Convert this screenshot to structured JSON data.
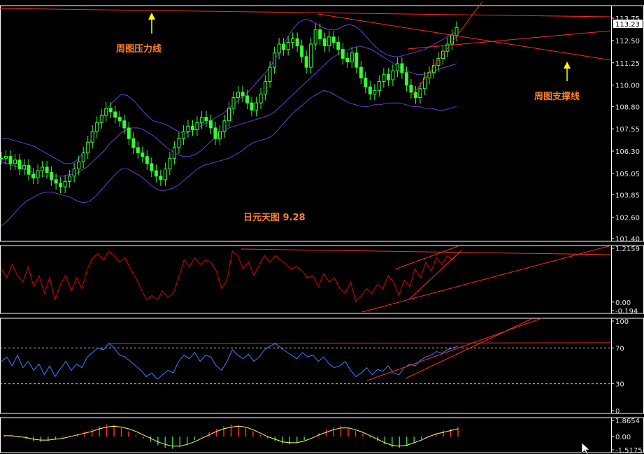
{
  "colors": {
    "background": "#000000",
    "frame": "#ffffff",
    "candle": "#33ff33",
    "bollinger": "#6a3fd8",
    "trendline": "#ff2a2a",
    "oscillator_line": "#e00000",
    "rsi_line": "#3a7fff",
    "annotation_text": "#ff7f2a",
    "arrow": "#ffff00",
    "macd_pos": "#ff2a2a",
    "macd_neg": "#2ecc40",
    "macd_line": "#ffff66"
  },
  "annotations": {
    "weekly_resistance": "周图压力线",
    "weekly_support": "周图支撑线",
    "chart_title": "日元天图  9.28"
  },
  "chart_data": [
    {
      "panel": "price",
      "type": "candlestick",
      "title": "日元天图  9.28",
      "current_price_label": "113.23",
      "ylim": [
        101.4,
        114.3
      ],
      "y_tick_labels": [
        "113.75",
        "112.50",
        "111.25",
        "110.00",
        "108.80",
        "107.55",
        "106.30",
        "105.05",
        "103.85",
        "102.60",
        "101.40"
      ],
      "y_ticks": [
        113.75,
        112.5,
        111.25,
        110.0,
        108.8,
        107.55,
        106.3,
        105.05,
        103.85,
        102.6,
        101.4
      ],
      "close": [
        105.9,
        106.0,
        105.6,
        105.8,
        105.3,
        105.5,
        105.0,
        104.8,
        105.2,
        105.4,
        105.1,
        104.7,
        104.5,
        104.3,
        104.6,
        104.9,
        105.3,
        105.7,
        106.2,
        106.8,
        107.4,
        107.9,
        108.3,
        108.7,
        108.5,
        108.2,
        108.0,
        107.6,
        107.0,
        106.5,
        106.2,
        106.0,
        105.6,
        105.2,
        104.9,
        104.7,
        105.3,
        105.9,
        106.5,
        107.0,
        107.4,
        107.7,
        107.5,
        107.9,
        108.2,
        108.0,
        107.6,
        107.0,
        107.4,
        108.0,
        108.7,
        109.3,
        109.6,
        109.4,
        109.0,
        108.6,
        109.0,
        109.5,
        110.2,
        111.0,
        111.8,
        112.3,
        112.0,
        112.4,
        112.6,
        112.2,
        111.6,
        111.0,
        112.3,
        113.1,
        112.6,
        112.2,
        112.7,
        112.4,
        112.0,
        111.5,
        111.3,
        111.8,
        111.0,
        110.4,
        109.9,
        109.5,
        109.7,
        110.2,
        110.6,
        110.3,
        110.8,
        111.2,
        110.7,
        110.0,
        109.6,
        109.3,
        109.8,
        110.4,
        110.7,
        111.1,
        111.5,
        111.9,
        112.3,
        112.8,
        113.23
      ],
      "ma": [
        105.7,
        105.6,
        105.5,
        105.4,
        105.3,
        105.2,
        105.0,
        104.9,
        104.9,
        104.9,
        104.9,
        104.9,
        105.0,
        105.0,
        105.2,
        105.4,
        105.7,
        106.0,
        106.3,
        106.7,
        107.0,
        107.3,
        107.5,
        107.6,
        107.6,
        107.5,
        107.3,
        107.1,
        106.8,
        106.5,
        106.3,
        106.1,
        106.0,
        106.0,
        106.1,
        106.3,
        106.6,
        106.9,
        107.2,
        107.4,
        107.6,
        107.7,
        107.8,
        107.9,
        108.0,
        108.1,
        108.2,
        108.3,
        108.5,
        108.8,
        109.1,
        109.4,
        109.7,
        110.0,
        110.3,
        110.6,
        110.9,
        111.2,
        111.5,
        111.7,
        111.9,
        112.0,
        112.1,
        112.2,
        112.1,
        112.0,
        111.8,
        111.6,
        111.4,
        111.2,
        111.0,
        110.8,
        110.7,
        110.6,
        110.6,
        110.7,
        110.8,
        110.9,
        111.0,
        111.1,
        111.2
      ],
      "upper_band": [
        107.0,
        107.0,
        106.9,
        106.8,
        106.7,
        106.6,
        106.4,
        106.2,
        106.0,
        105.8,
        105.6,
        105.6,
        105.8,
        106.2,
        106.8,
        107.5,
        108.2,
        108.8,
        109.2,
        109.5,
        109.4,
        109.1,
        108.7,
        108.3,
        108.0,
        107.9,
        107.8,
        107.6,
        107.4,
        107.3,
        107.4,
        107.6,
        107.8,
        108.0,
        108.2,
        108.4,
        108.7,
        109.0,
        109.3,
        109.6,
        110.0,
        110.4,
        110.8,
        111.3,
        111.9,
        112.5,
        113.1,
        113.5,
        113.7,
        113.6,
        113.4,
        113.2,
        113.1,
        113.1,
        113.3,
        113.4,
        113.3,
        113.0,
        112.6,
        112.2,
        111.9,
        111.7,
        111.6,
        111.6,
        111.7,
        111.8,
        111.9,
        112.0,
        112.2,
        112.4,
        112.6,
        112.8,
        113.0
      ],
      "lower_band": [
        102.1,
        102.4,
        102.8,
        103.2,
        103.5,
        103.7,
        103.9,
        104.0,
        104.0,
        103.9,
        103.8,
        103.7,
        103.5,
        103.4,
        103.5,
        103.8,
        104.2,
        104.6,
        105.0,
        105.3,
        105.3,
        105.1,
        104.9,
        104.6,
        104.3,
        104.1,
        104.1,
        104.2,
        104.4,
        104.7,
        105.0,
        105.3,
        105.5,
        105.6,
        105.7,
        105.8,
        105.9,
        106.1,
        106.3,
        106.6,
        106.8,
        106.9,
        107.0,
        107.2,
        107.6,
        108.0,
        108.4,
        108.7,
        109.0,
        109.3,
        109.5,
        109.7,
        109.6,
        109.4,
        109.2,
        109.0,
        108.9,
        108.8,
        108.8,
        108.9,
        108.9,
        109.0,
        109.0,
        109.0,
        108.9,
        108.8,
        108.8,
        108.7,
        108.7,
        108.6,
        108.6,
        108.7,
        108.8
      ]
    },
    {
      "panel": "oscillator",
      "type": "line",
      "ylim": [
        -0.194,
        1.2159
      ],
      "y_tick_labels": [
        "1.2159",
        "0.00",
        "-0.194"
      ],
      "y_ticks": [
        1.2159,
        0.0,
        -0.194
      ],
      "values": [
        0.75,
        0.55,
        0.85,
        0.6,
        0.45,
        0.8,
        0.35,
        0.6,
        0.2,
        0.55,
        0.05,
        0.4,
        0.6,
        0.25,
        0.55,
        0.3,
        0.75,
        1.0,
        1.1,
        0.95,
        1.15,
        1.05,
        0.9,
        1.0,
        0.75,
        0.55,
        0.3,
        0.05,
        0.15,
        0.05,
        0.25,
        0.1,
        0.2,
        0.55,
        0.95,
        0.8,
        1.0,
        0.85,
        0.95,
        0.9,
        0.7,
        0.3,
        0.5,
        1.15,
        1.05,
        0.75,
        0.9,
        0.6,
        0.85,
        1.05,
        0.9,
        1.05,
        0.95,
        0.85,
        0.75,
        0.8,
        0.7,
        0.55,
        0.6,
        0.35,
        0.65,
        0.45,
        0.55,
        0.3,
        0.2,
        0.45,
        0.0,
        0.15,
        0.3,
        0.2,
        0.4,
        0.3,
        0.6,
        0.45,
        0.15,
        0.5,
        0.35,
        0.75,
        0.55,
        0.9,
        0.7,
        1.0,
        0.85,
        1.05,
        0.95,
        1.1
      ]
    },
    {
      "panel": "rsi",
      "type": "line",
      "ylim": [
        0,
        100
      ],
      "y_tick_labels": [
        "100",
        "70",
        "30",
        "0"
      ],
      "y_ticks": [
        100,
        70,
        30,
        0
      ],
      "levels": [
        70,
        30
      ],
      "values": [
        55,
        60,
        50,
        62,
        48,
        55,
        45,
        52,
        40,
        50,
        38,
        47,
        55,
        45,
        52,
        48,
        60,
        65,
        70,
        68,
        75,
        70,
        62,
        60,
        55,
        50,
        45,
        38,
        42,
        35,
        40,
        45,
        42,
        55,
        62,
        58,
        65,
        55,
        62,
        60,
        50,
        45,
        55,
        68,
        62,
        58,
        63,
        55,
        60,
        68,
        72,
        75,
        70,
        66,
        62,
        58,
        65,
        60,
        62,
        55,
        60,
        52,
        48,
        50,
        55,
        45,
        38,
        42,
        48,
        40,
        46,
        44,
        50,
        42,
        40,
        48,
        52,
        50,
        56,
        60,
        62,
        66,
        64,
        68,
        70,
        72
      ]
    },
    {
      "panel": "macd",
      "type": "bar",
      "ylim": [
        -1.5175,
        1.8654
      ],
      "y_tick_labels": [
        "1.8654",
        "0.00",
        "-1.5175"
      ],
      "y_ticks": [
        1.8654,
        0.0,
        -1.5175
      ],
      "histogram": [
        0.2,
        0.1,
        -0.1,
        -0.3,
        -0.5,
        -0.6,
        -0.5,
        -0.3,
        -0.1,
        0.1,
        0.3,
        0.6,
        0.9,
        1.2,
        1.4,
        1.3,
        1.0,
        0.6,
        0.2,
        -0.2,
        -0.6,
        -1.0,
        -1.3,
        -1.4,
        -1.2,
        -0.8,
        -0.4,
        0.1,
        0.5,
        0.9,
        1.2,
        1.4,
        1.3,
        1.0,
        0.6,
        0.2,
        -0.2,
        -0.5,
        -0.8,
        -0.9,
        -0.7,
        -0.4,
        0.0,
        0.4,
        0.8,
        1.1,
        1.2,
        1.0,
        0.7,
        0.3,
        -0.1,
        -0.5,
        -0.9,
        -1.2,
        -1.3,
        -1.1,
        -0.7,
        -0.3,
        0.1,
        0.4,
        0.7,
        0.9,
        1.1
      ],
      "signal": [
        0.1,
        0.1,
        0.0,
        -0.1,
        -0.3,
        -0.4,
        -0.4,
        -0.3,
        -0.2,
        0.0,
        0.2,
        0.4,
        0.6,
        0.9,
        1.1,
        1.2,
        1.1,
        0.9,
        0.6,
        0.2,
        -0.2,
        -0.6,
        -0.9,
        -1.1,
        -1.1,
        -0.9,
        -0.6,
        -0.2,
        0.2,
        0.6,
        0.9,
        1.1,
        1.2,
        1.1,
        0.8,
        0.4,
        0.0,
        -0.3,
        -0.6,
        -0.7,
        -0.7,
        -0.5,
        -0.2,
        0.2,
        0.5,
        0.8,
        1.0,
        1.0,
        0.8,
        0.5,
        0.1,
        -0.3,
        -0.7,
        -1.0,
        -1.1,
        -1.0,
        -0.7,
        -0.4,
        0.0,
        0.3,
        0.5,
        0.7,
        0.9
      ]
    }
  ]
}
